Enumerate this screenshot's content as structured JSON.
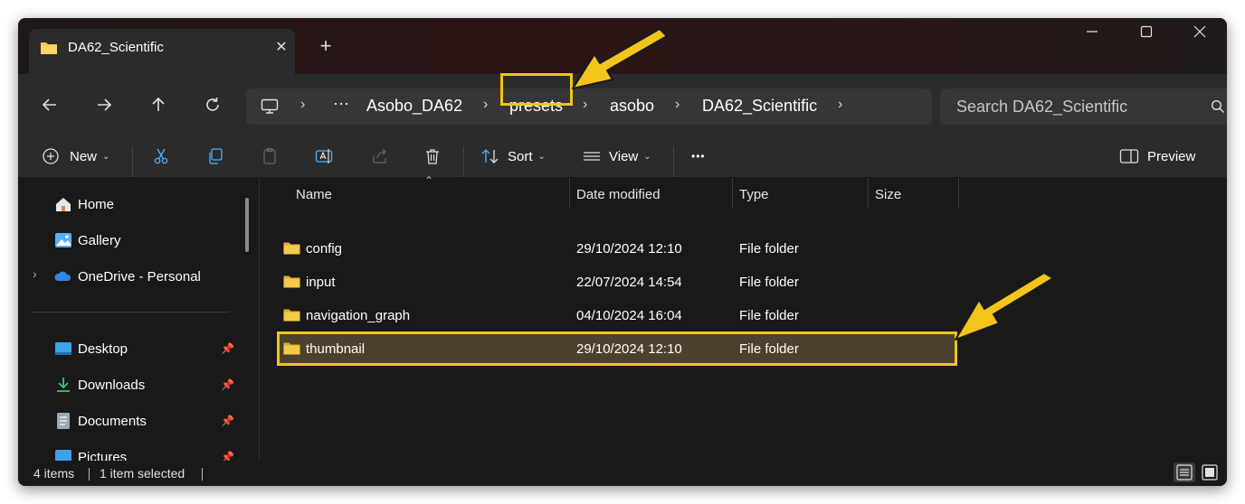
{
  "window": {
    "tab_title": "DA62_Scientific",
    "tab_close": "✕",
    "new_tab": "+",
    "controls": {
      "minimize": "—",
      "maximize": "☐",
      "close": "✕"
    }
  },
  "nav": {
    "back": "←",
    "forward": "→",
    "up": "↑",
    "refresh": "↻"
  },
  "address": {
    "crumbs": [
      "Asobo_DA62",
      "presets",
      "asobo",
      "DA62_Scientific"
    ],
    "overflow": "···",
    "separator": "›"
  },
  "search": {
    "placeholder": "Search DA62_Scientific"
  },
  "toolbar": {
    "new_label": "New",
    "sort_label": "Sort",
    "view_label": "View",
    "more_label": "•••",
    "preview_label": "Preview"
  },
  "sidebar": {
    "items": [
      {
        "label": "Home",
        "icon": "home-icon"
      },
      {
        "label": "Gallery",
        "icon": "gallery-icon"
      },
      {
        "label": "OneDrive - Personal",
        "icon": "onedrive-icon"
      },
      {
        "label": "Desktop",
        "icon": "desktop-icon",
        "pinned": true
      },
      {
        "label": "Downloads",
        "icon": "downloads-icon",
        "pinned": true
      },
      {
        "label": "Documents",
        "icon": "documents-icon",
        "pinned": true
      },
      {
        "label": "Pictures",
        "icon": "pictures-icon",
        "pinned": true
      }
    ]
  },
  "files": {
    "columns": [
      "Name",
      "Date modified",
      "Type",
      "Size"
    ],
    "rows": [
      {
        "name": "config",
        "modified": "29/10/2024 12:10",
        "type": "File folder",
        "size": ""
      },
      {
        "name": "input",
        "modified": "22/07/2024 14:54",
        "type": "File folder",
        "size": ""
      },
      {
        "name": "navigation_graph",
        "modified": "04/10/2024 16:04",
        "type": "File folder",
        "size": ""
      },
      {
        "name": "thumbnail",
        "modified": "29/10/2024 12:10",
        "type": "File folder",
        "size": "",
        "selected": true
      }
    ]
  },
  "status": {
    "count": "4 items",
    "selection": "1 item selected"
  },
  "colors": {
    "highlight": "#f3c419",
    "folder": "#f5c94a",
    "selected_row": "#4b422e"
  }
}
